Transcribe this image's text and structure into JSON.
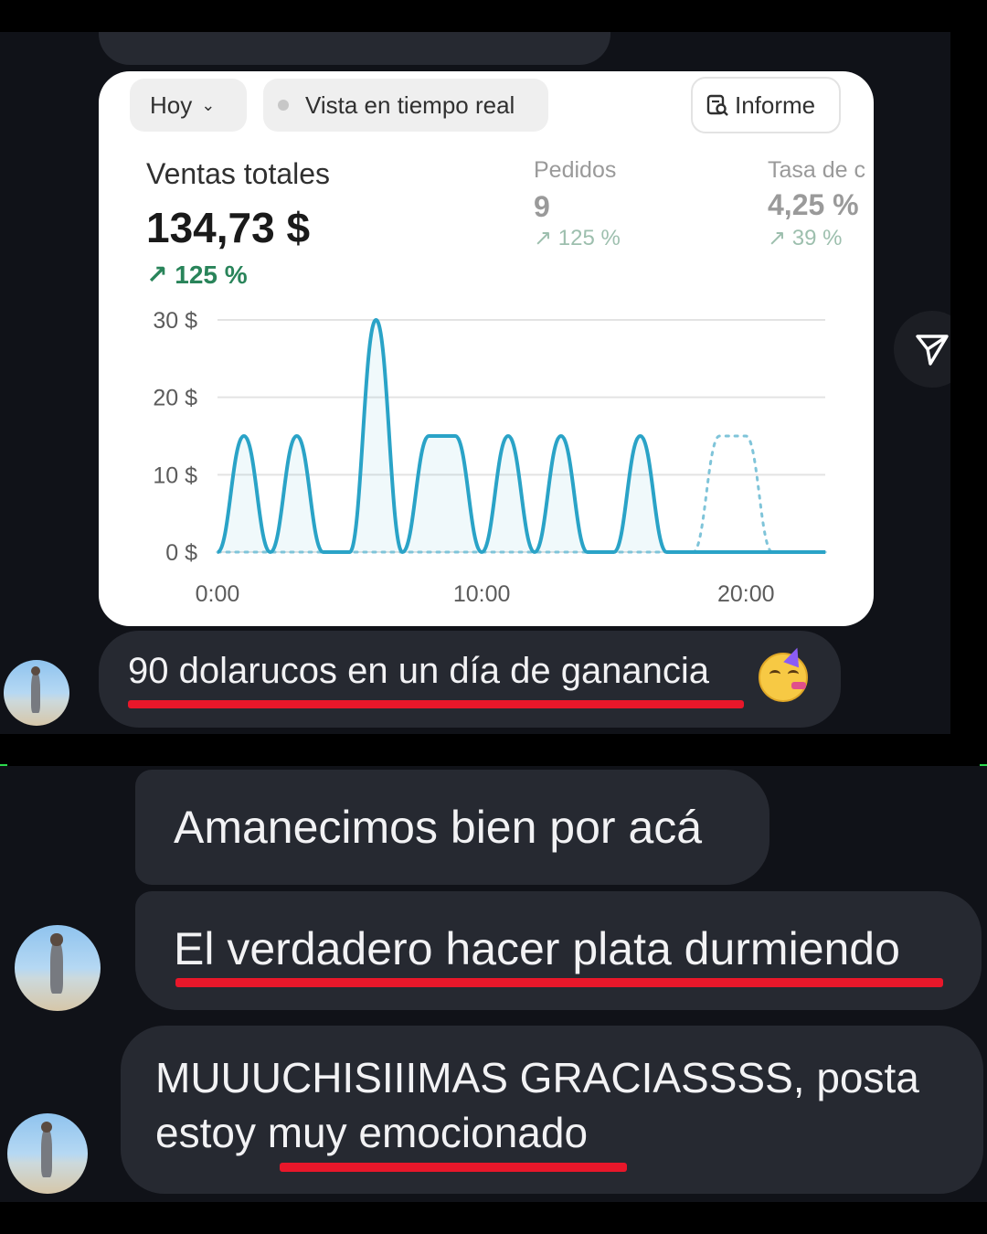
{
  "dashboard": {
    "date_filter": "Hoy",
    "live_view": "Vista en tiempo real",
    "report_button": "Informe",
    "sales_label": "Ventas totales",
    "sales_value": "134,73 $",
    "sales_change": "125 %",
    "orders_label": "Pedidos",
    "orders_value": "9",
    "orders_change": "125 %",
    "rate_label": "Tasa de c",
    "rate_value": "4,25 %",
    "rate_change": "39 %",
    "accent_color": "#2aa3c7",
    "positive_color": "#29845a"
  },
  "chart_data": {
    "type": "line",
    "xlabel": "",
    "ylabel": "",
    "x_ticks": [
      "0:00",
      "10:00",
      "20:00"
    ],
    "y_ticks": [
      "30 $",
      "20 $",
      "10 $",
      "0 $"
    ],
    "ylim": [
      0,
      30
    ],
    "xlim": [
      0,
      23
    ],
    "grid": true,
    "x": [
      0,
      1,
      2,
      3,
      4,
      5,
      6,
      7,
      8,
      9,
      10,
      11,
      12,
      13,
      14,
      15,
      16,
      17,
      18,
      19,
      20,
      21,
      22,
      23
    ],
    "series": [
      {
        "values": [
          0,
          15,
          0,
          15,
          0,
          0,
          30,
          0,
          15,
          15,
          0,
          15,
          0,
          15,
          0,
          0,
          15,
          0,
          0,
          0,
          0,
          0,
          0,
          0
        ]
      },
      {
        "values": [
          0,
          0,
          0,
          0,
          0,
          0,
          0,
          0,
          0,
          0,
          0,
          0,
          0,
          0,
          0,
          0,
          0,
          0,
          0,
          15,
          15,
          0,
          0,
          0
        ]
      }
    ]
  },
  "chat": {
    "caption": "90 dolarucos en un día de ganancia",
    "messages": [
      "Amanecimos bien por acá",
      "El verdadero hacer plata durmiendo",
      "MUUUCHISIIIMAS GRACIASSSS, posta",
      "estoy muy emocionado"
    ]
  }
}
